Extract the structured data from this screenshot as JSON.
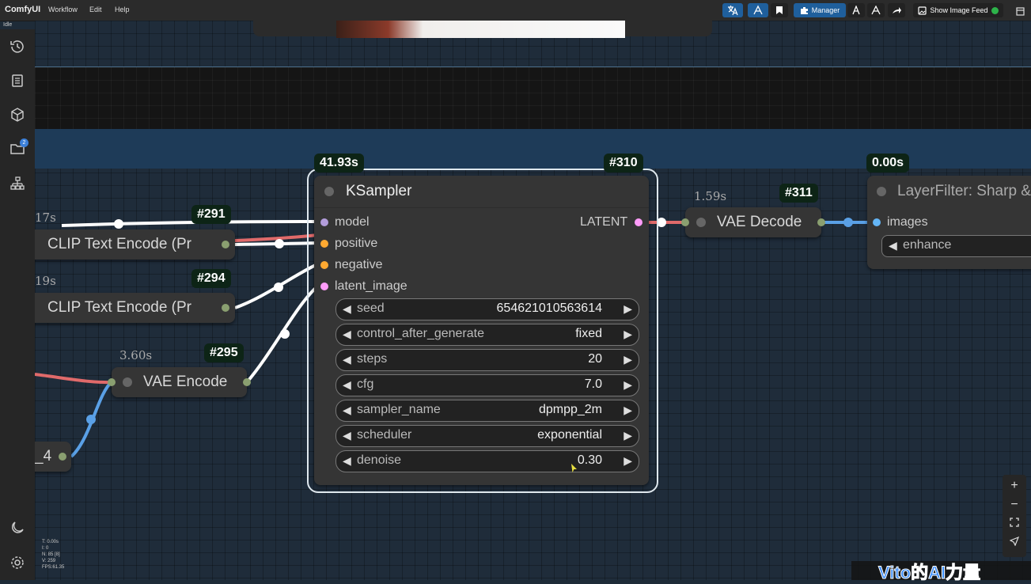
{
  "menubar": {
    "brand": "ComfyUI",
    "items": [
      "Workflow",
      "Edit",
      "Help"
    ],
    "status": "Idle",
    "manager_label": "Manager",
    "image_feed_label": "Show Image Feed"
  },
  "sidebar": {
    "icons": [
      "history-icon",
      "queue-icon",
      "model-library-icon",
      "workflows-icon",
      "node-library-icon"
    ],
    "badge_count": "2",
    "bottom_icons": [
      "theme-toggle-icon",
      "settings-icon"
    ]
  },
  "nodes": {
    "clip_291": {
      "time": "17s",
      "tag": "#291",
      "title": "CLIP Text Encode (Pr"
    },
    "clip_294": {
      "time": "19s",
      "tag": "#294",
      "title": "CLIP Text Encode (Pr"
    },
    "vae_encode": {
      "time": "3.60s",
      "tag": "#295",
      "title": "VAE Encode"
    },
    "partial_node": {
      "title": "_4"
    },
    "ksampler": {
      "time": "41.93s",
      "tag": "#310",
      "title": "KSampler",
      "inputs": [
        "model",
        "positive",
        "negative",
        "latent_image"
      ],
      "output": "LATENT",
      "widgets": [
        {
          "name": "seed",
          "value": "654621010563614"
        },
        {
          "name": "control_after_generate",
          "value": "fixed"
        },
        {
          "name": "steps",
          "value": "20"
        },
        {
          "name": "cfg",
          "value": "7.0"
        },
        {
          "name": "sampler_name",
          "value": "dpmpp_2m"
        },
        {
          "name": "scheduler",
          "value": "exponential"
        },
        {
          "name": "denoise",
          "value": "0.30"
        }
      ]
    },
    "vae_decode": {
      "time": "1.59s",
      "tag": "#311",
      "title": "VAE Decode"
    },
    "layer_filter": {
      "time": "0.00s",
      "title": "LayerFilter: Sharp &",
      "input": "images",
      "widget": "enhance"
    }
  },
  "stats": [
    "T: 0.00s",
    "I: 0",
    "N: 85 [8]",
    "V: 259",
    "FPS:61.35"
  ],
  "watermark": "Vito的AI力量",
  "colors": {
    "port_model": "#b39ddb",
    "port_conditioning": "#ffa931",
    "port_latent": "#ff9cf9",
    "port_image": "#64b5f6",
    "link_red": "#e06a6a",
    "link_blue": "#5aa0e6",
    "tag_bg": "#0d2416",
    "accent": "#1f5f9c"
  }
}
